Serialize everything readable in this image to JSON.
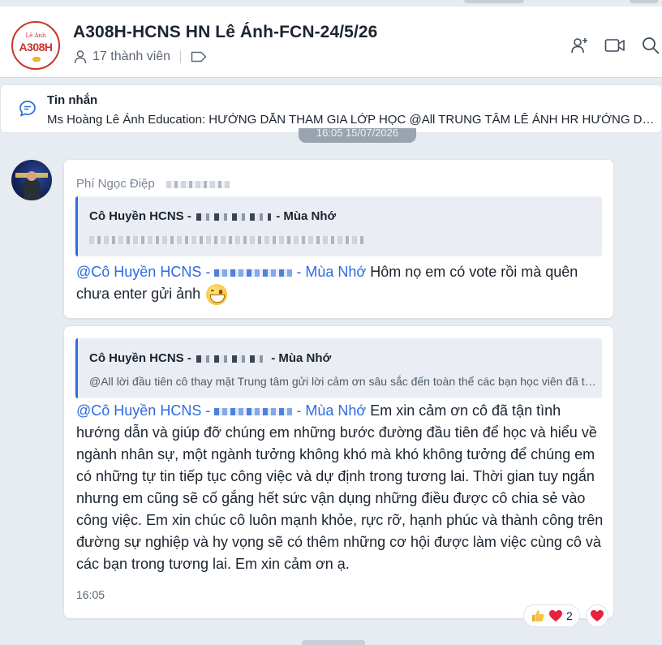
{
  "header": {
    "title": "A308H-HCNS HN Lê Ánh-FCN-24/5/26",
    "members": "17 thành viên",
    "logo_top": "Lê Ánh",
    "logo_code": "A308H"
  },
  "pinned": {
    "label": "Tin nhắn",
    "text": "Ms Hoàng Lê Ánh Education: HƯỚNG DẪN THAM GIA LỚP HỌC @All TRUNG TÂM LÊ ÁNH HR HƯỚNG DẪN..."
  },
  "date_divider": "16:05 15/07/2026",
  "messages": [
    {
      "sender": "Phí Ngọc Điệp",
      "quote_name_prefix": "Cô Huyền HCNS -",
      "quote_name_suffix": "- Mùa Nhớ",
      "mention_prefix": "@Cô Huyền HCNS -",
      "mention_suffix": "- Mùa Nhớ",
      "text": " Hôm nọ em có vote rồi mà quên chưa enter gửi ảnh "
    },
    {
      "quote_name_prefix": "Cô Huyền HCNS -",
      "quote_name_suffix": "- Mùa Nhớ",
      "quote_text": "@All lời đầu tiên cô thay mặt Trung tâm gửi lời cảm ơn sâu sắc đến toàn thể các bạn học viên đã tham gia khóa học",
      "mention_prefix": "@Cô Huyền HCNS -",
      "mention_suffix": "- Mùa Nhớ",
      "text": " Em xin cảm ơn cô đã tận tình hướng dẫn và giúp đỡ chúng em những bước đường đầu tiên để học và hiểu về ngành nhân sự, một ngành tưởng không khó mà khó không tưởng để chúng em có những tự tin tiếp tục công việc và dự định trong tương lai. Thời gian tuy ngắn nhưng em cũng sẽ cố gắng hết sức vận dụng những điều được cô chia sẻ vào công việc. Em xin chúc cô luôn mạnh khỏe, rực rỡ, hạnh phúc và thành công trên đường sự nghiệp và hy vọng sẽ có thêm những cơ hội được làm việc cùng cô và các bạn trong tương lai. Em xin cảm ơn ạ.",
      "time": "16:05"
    }
  ],
  "reactions": {
    "count": "2"
  },
  "colors": {
    "accent": "#2d6be0",
    "heart": "#e8213f",
    "like": "#f6b93b"
  }
}
